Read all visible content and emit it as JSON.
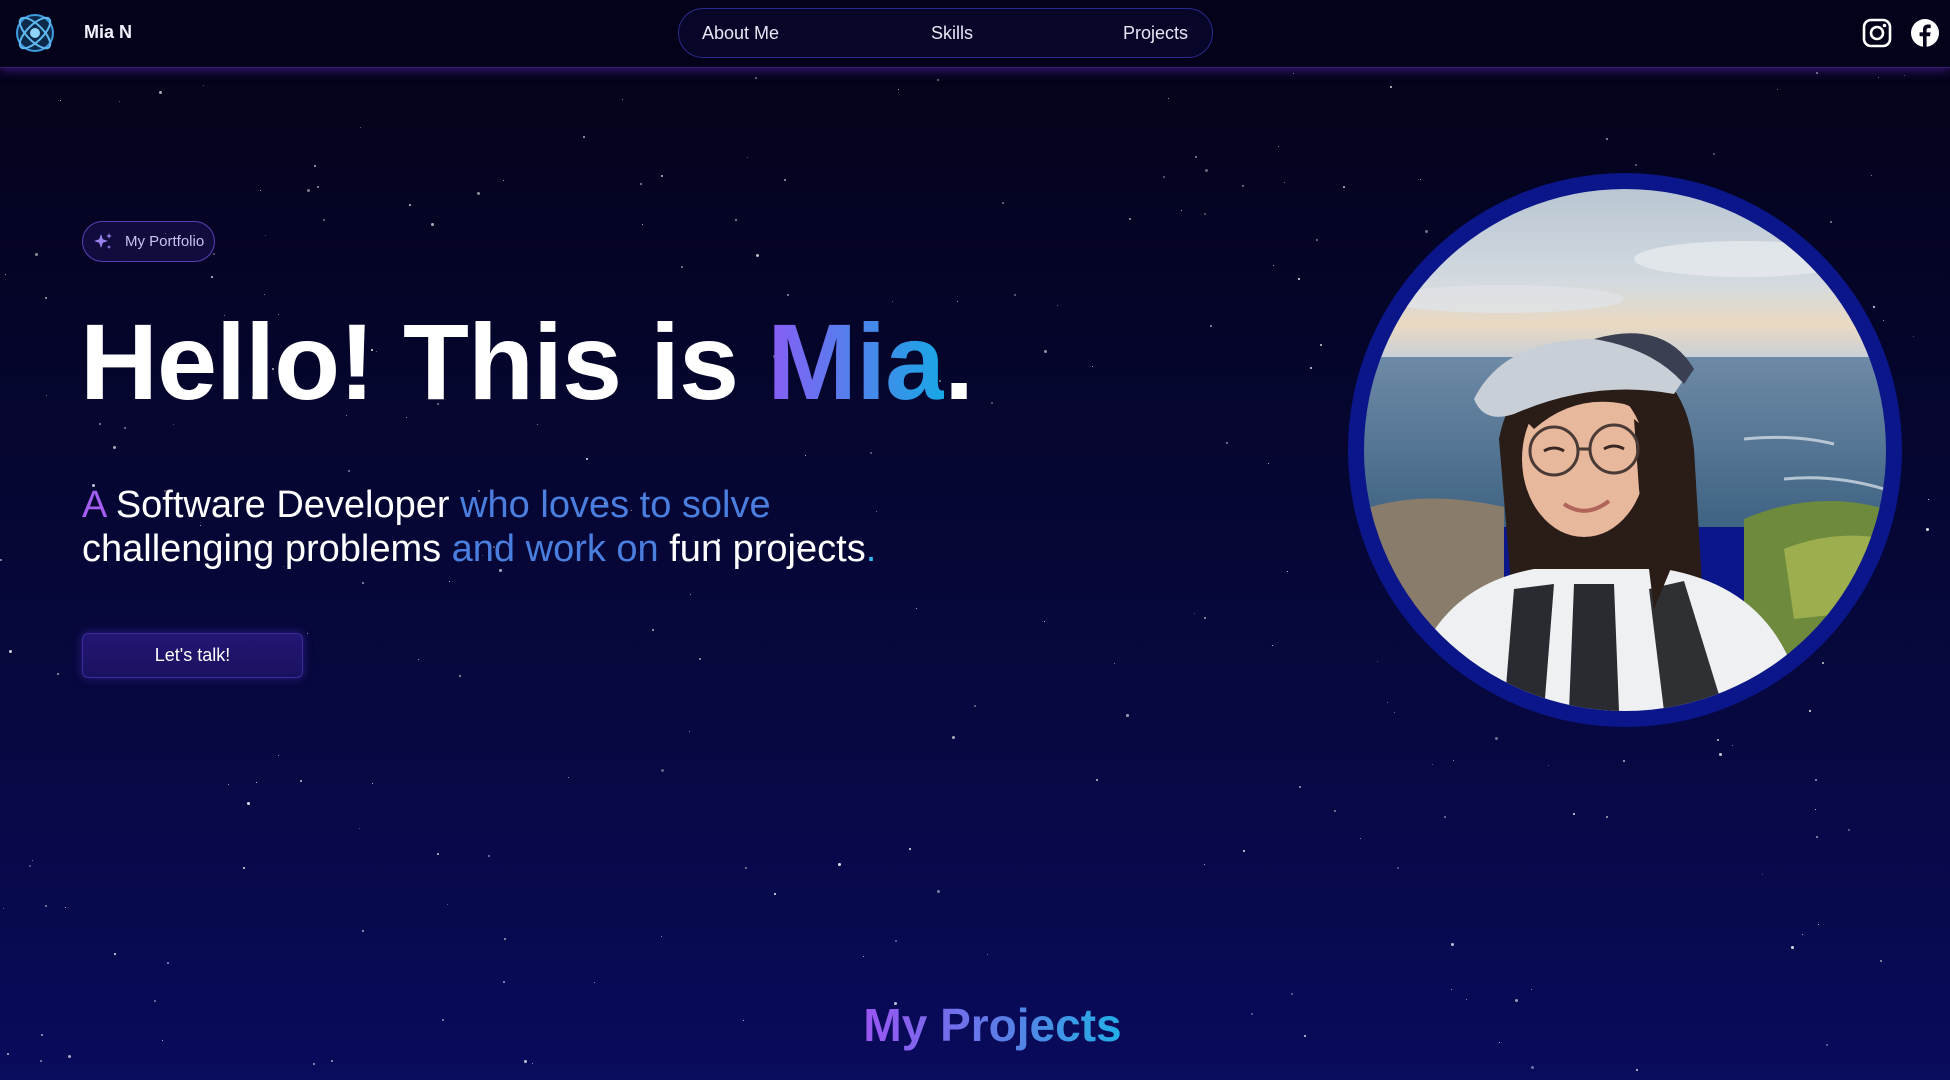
{
  "header": {
    "brand": "Mia N",
    "logo_icon": "atom-logo-icon",
    "nav": [
      {
        "label": "About Me"
      },
      {
        "label": "Skills"
      },
      {
        "label": "Projects"
      }
    ],
    "social": [
      {
        "icon": "instagram-icon"
      },
      {
        "icon": "facebook-icon"
      }
    ]
  },
  "hero": {
    "badge": {
      "icon": "sparkles-icon",
      "label": "My Portfolio"
    },
    "headline": {
      "prefix": "Hello! This is ",
      "name": "Mia",
      "suffix": "."
    },
    "tagline": {
      "line1": [
        {
          "text": "A ",
          "tone": "purple"
        },
        {
          "text": "Software Developer ",
          "tone": "white"
        },
        {
          "text": "who loves to solve",
          "tone": "blue"
        }
      ],
      "line2": [
        {
          "text": "challenging problems",
          "tone": "white"
        },
        {
          "text": " and work on ",
          "tone": "blue"
        },
        {
          "text": "fun projects",
          "tone": "white"
        },
        {
          "text": ".",
          "tone": "cyan"
        }
      ]
    },
    "cta_label": "Let's talk!",
    "portrait": "profile-photo"
  },
  "projects": {
    "title": "My Projects"
  },
  "colors": {
    "background": "#05041f",
    "accent_purple": "#8a5cf6",
    "accent_blue": "#3e8ee8",
    "accent_cyan": "#19a7e6",
    "ring": "#0b168a"
  }
}
